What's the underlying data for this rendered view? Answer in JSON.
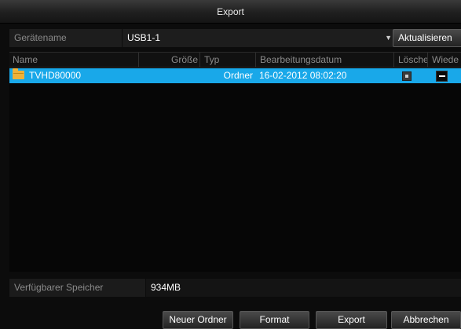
{
  "window": {
    "title": "Export"
  },
  "device": {
    "label": "Gerätename",
    "selected": "USB1-1",
    "refresh_label": "Aktualisieren"
  },
  "table": {
    "columns": {
      "name": "Name",
      "size": "Größe",
      "type": "Typ",
      "date": "Bearbeitungsdatum",
      "delete": "Lösche",
      "play": "Wiede"
    },
    "rows": [
      {
        "name": "TVHD80000",
        "size": "",
        "type": "Ordner",
        "date": "16-02-2012 08:02:20",
        "icon": "folder-icon"
      }
    ]
  },
  "storage": {
    "label": "Verfügbarer Speicher",
    "value": "934MB"
  },
  "footer": {
    "new_folder_label": "Neuer Ordner",
    "format_label": "Format",
    "export_label": "Export",
    "cancel_label": "Abbrechen"
  },
  "colors": {
    "selection": "#19a8e9",
    "folder": "#f0b23a",
    "background": "#0c0c0c"
  }
}
